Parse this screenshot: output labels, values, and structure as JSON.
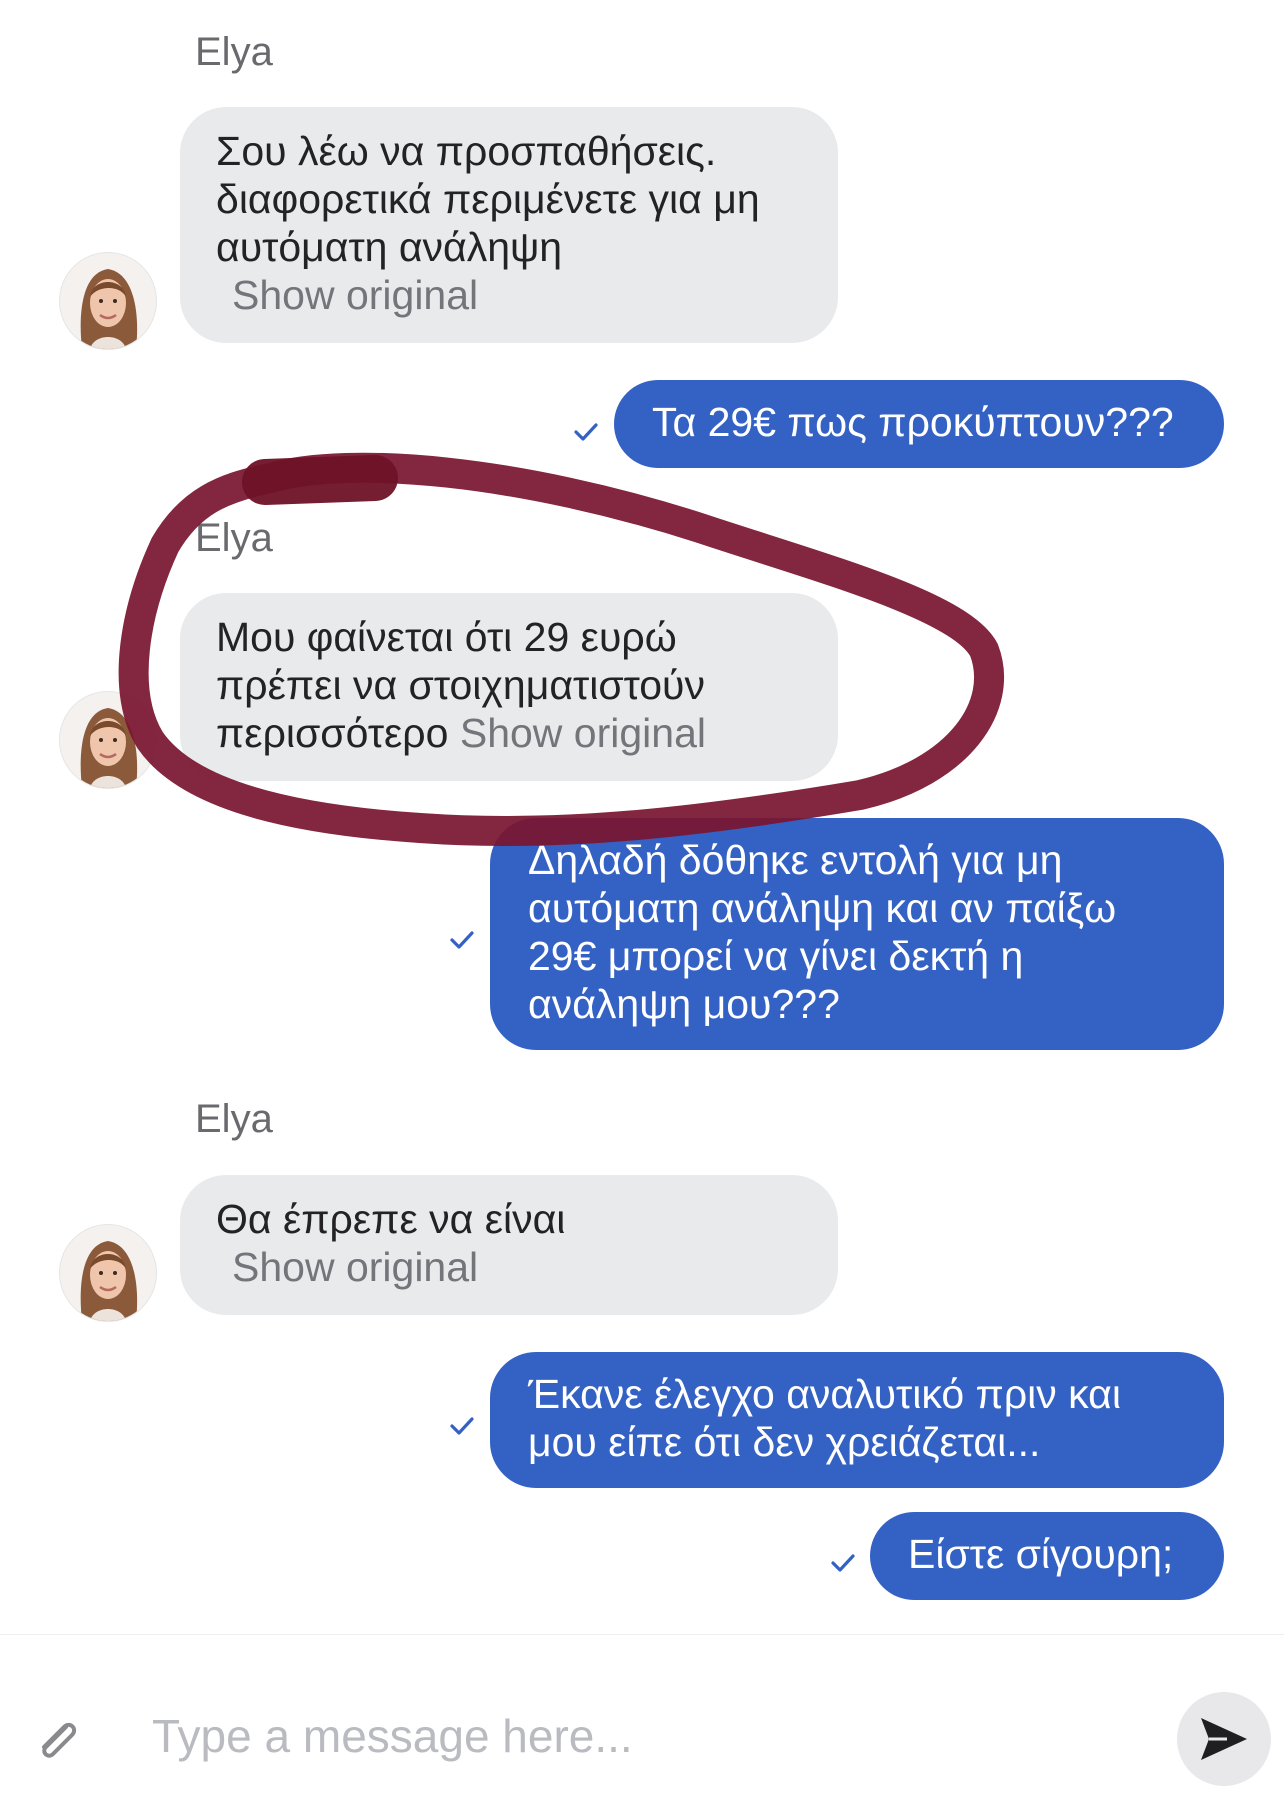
{
  "messages": [
    {
      "sender": "Elya",
      "text": "Σου λέω να προσπαθήσεις. διαφορετικά περιμένετε για μη αυτόματη ανάληψη",
      "show_original": "Show original"
    },
    {
      "text": "Τα 29€ πως προκύπτουν???"
    },
    {
      "sender": "Elya",
      "text": "Μου φαίνεται ότι 29 ευρώ πρέπει να στοιχηματιστούν περισσότερο",
      "show_original": "Show original"
    },
    {
      "text": "Δηλαδή δόθηκε εντολή για μη αυτόματη ανάληψη και αν παίξω 29€ μπορεί να γίνει δεκτή η ανάληψη μου???"
    },
    {
      "sender": "Elya",
      "text": "Θα έπρεπε να είναι",
      "show_original": "Show original"
    },
    {
      "text": "Έκανε έλεγχο αναλυτικό πριν και μου είπε ότι δεν χρειάζεται..."
    },
    {
      "text": "Είστε σίγουρη;"
    }
  ],
  "composer": {
    "placeholder": "Type a message here..."
  },
  "icons": {
    "attach": "paperclip-icon",
    "send": "send-arrow-icon",
    "delivered": "checkmark-icon"
  },
  "colors": {
    "outgoing_bubble": "#3461c4",
    "incoming_bubble": "#e9eaec",
    "annotation": "#7a1630",
    "check": "#3461c4"
  }
}
